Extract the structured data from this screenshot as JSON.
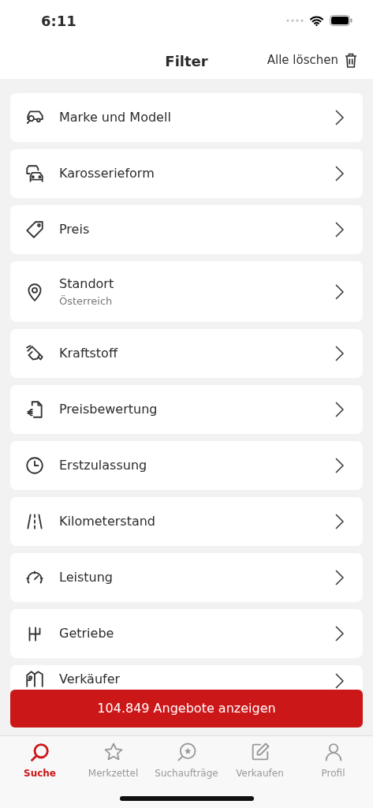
{
  "status_bar": {
    "time": "6:11"
  },
  "header": {
    "title": "Filter",
    "clear_all": "Alle löschen"
  },
  "filters": [
    {
      "label": "Marke und Modell"
    },
    {
      "label": "Karosserieform"
    },
    {
      "label": "Preis"
    },
    {
      "label": "Standort",
      "value": "Österreich"
    },
    {
      "label": "Kraftstoff"
    },
    {
      "label": "Preisbewertung"
    },
    {
      "label": "Erstzulassung"
    },
    {
      "label": "Kilometerstand"
    },
    {
      "label": "Leistung"
    },
    {
      "label": "Getriebe"
    },
    {
      "label": "Verkäufer"
    }
  ],
  "show_results_button": "104.849 Angebote anzeigen",
  "tab_bar": [
    {
      "label": "Suche",
      "selected": true
    },
    {
      "label": "Merkzettel",
      "selected": false
    },
    {
      "label": "Suchaufträge",
      "selected": false
    },
    {
      "label": "Verkaufen",
      "selected": false
    },
    {
      "label": "Profil",
      "selected": false
    }
  ]
}
